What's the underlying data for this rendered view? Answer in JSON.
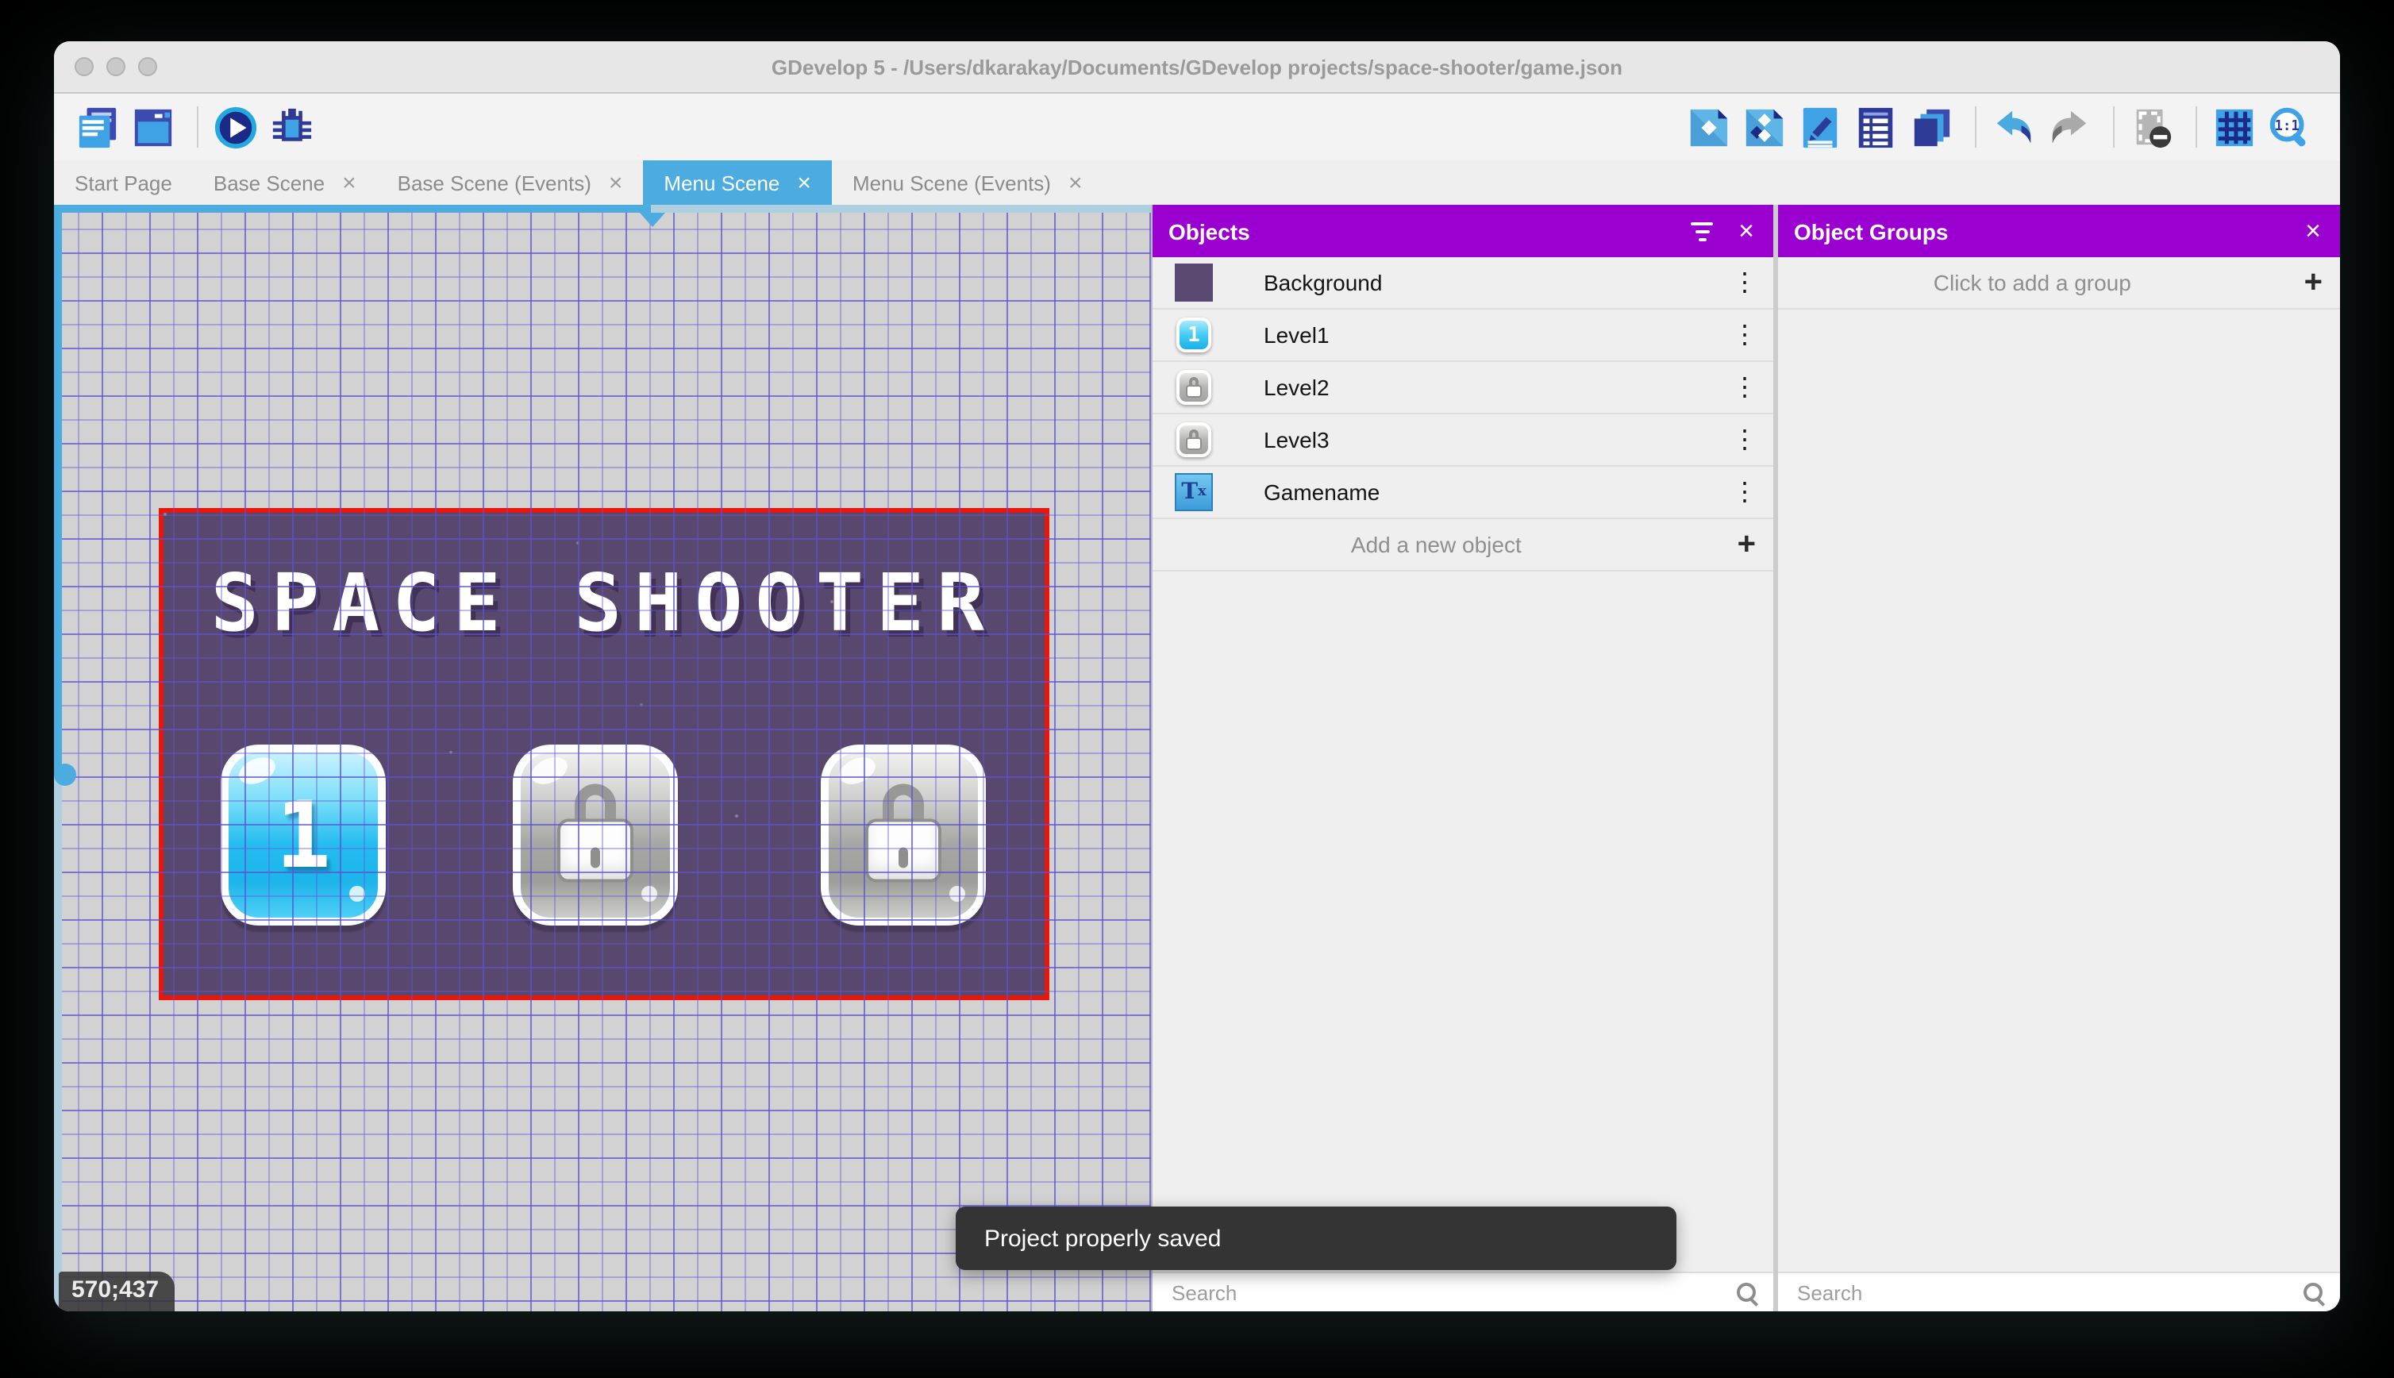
{
  "window": {
    "title": "GDevelop 5 - /Users/dkarakay/Documents/GDevelop projects/space-shooter/game.json"
  },
  "toolbar": {
    "left_icons": [
      "project-manager-icon",
      "scene-window-icon",
      "play-icon",
      "debug-icon"
    ],
    "right_icons": [
      "objects-editor-icon",
      "object-groups-editor-icon",
      "properties-icon",
      "instances-list-icon",
      "layers-icon",
      "undo-icon",
      "redo-icon",
      "mask-icon",
      "grid-icon",
      "zoom-original-icon"
    ]
  },
  "tabs": [
    {
      "label": "Start Page",
      "closable": false,
      "active": false
    },
    {
      "label": "Base Scene",
      "closable": true,
      "active": false
    },
    {
      "label": "Base Scene (Events)",
      "closable": true,
      "active": false
    },
    {
      "label": "Menu Scene",
      "closable": true,
      "active": true
    },
    {
      "label": "Menu Scene (Events)",
      "closable": true,
      "active": false
    }
  ],
  "canvas": {
    "coordinates": "570;437",
    "scene": {
      "title": "SPACE SHOOTER",
      "buttons": [
        {
          "label": "1",
          "locked": false
        },
        {
          "label": "",
          "locked": true
        },
        {
          "label": "",
          "locked": true
        }
      ]
    }
  },
  "objects_panel": {
    "title": "Objects",
    "items": [
      {
        "name": "Background",
        "thumb": "purple-square"
      },
      {
        "name": "Level1",
        "thumb": "blue-button-1",
        "badge": "1"
      },
      {
        "name": "Level2",
        "thumb": "gray-lock-button"
      },
      {
        "name": "Level3",
        "thumb": "gray-lock-button"
      },
      {
        "name": "Gamename",
        "thumb": "text-object"
      }
    ],
    "add_label": "Add a new object",
    "search_placeholder": "Search"
  },
  "object_groups_panel": {
    "title": "Object Groups",
    "add_label": "Click to add a group",
    "search_placeholder": "Search"
  },
  "toast": {
    "message": "Project properly saved"
  },
  "glyphs": {
    "close": "×",
    "kebab": "⋮",
    "plus": "+",
    "tee": "T",
    "sub_x": "x"
  },
  "colors": {
    "panel_header_purple": "#9a01d0",
    "active_tab_blue": "#4cacdf",
    "selection_red": "#e8170b",
    "scene_background_purple": "#59486e",
    "canvas_gray": "#d2d2d2",
    "grid_blue": "#625cd7",
    "toast_dark": "#343434"
  }
}
